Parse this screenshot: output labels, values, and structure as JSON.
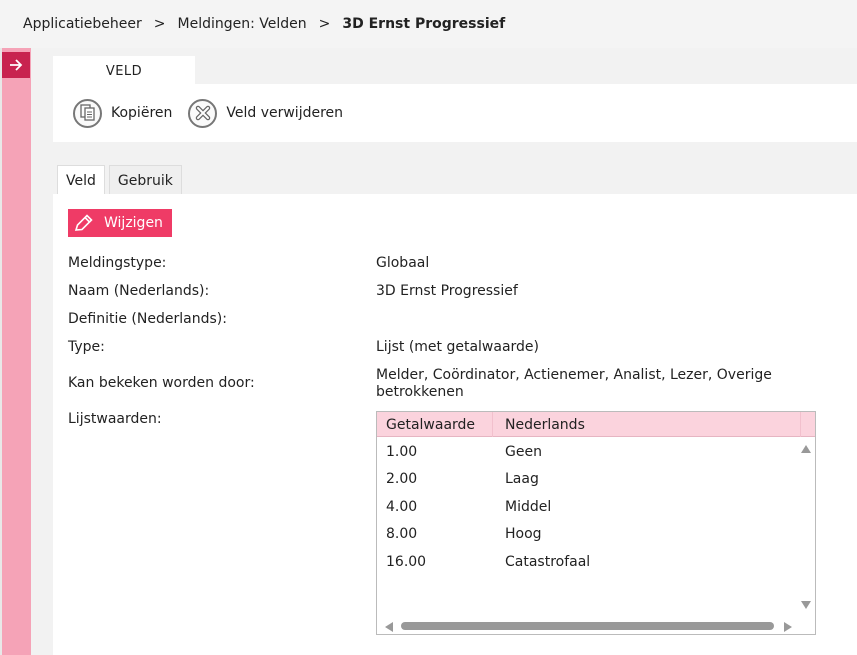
{
  "breadcrumb": {
    "items": [
      "Applicatiebeheer",
      "Meldingen: Velden",
      "3D Ernst Progressief"
    ],
    "separator": ">"
  },
  "top_tab": {
    "label": "VELD"
  },
  "toolbar": {
    "copy_label": "Kopiëren",
    "delete_label": "Veld verwijderen"
  },
  "subtabs": [
    "Veld",
    "Gebruik"
  ],
  "edit_button": {
    "label": "Wijzigen"
  },
  "fields": {
    "meldingstype": {
      "label": "Meldingstype:",
      "value": "Globaal"
    },
    "naam": {
      "label": "Naam (Nederlands):",
      "value": "3D Ernst Progressief"
    },
    "definitie": {
      "label": "Definitie (Nederlands):",
      "value": ""
    },
    "type": {
      "label": "Type:",
      "value": "Lijst (met getalwaarde)"
    },
    "bekeken": {
      "label": "Kan bekeken worden door:",
      "value": "Melder, Coördinator, Actienemer, Analist, Lezer, Overige betrokkenen"
    },
    "lijstwaarden": {
      "label": "Lijstwaarden:"
    }
  },
  "list_table": {
    "columns": [
      "Getalwaarde",
      "Nederlands"
    ],
    "rows": [
      [
        "1.00",
        "Geen"
      ],
      [
        "2.00",
        "Laag"
      ],
      [
        "4.00",
        "Middel"
      ],
      [
        "8.00",
        "Hoog"
      ],
      [
        "16.00",
        "Catastrofaal"
      ]
    ]
  },
  "colors": {
    "accent": "#ef3b66",
    "accent_dark": "#c8234f",
    "strip": "#f5a3b7",
    "table_header": "#fbd3dd"
  },
  "icons": {
    "expand": "arrow-right-icon",
    "copy": "copy-icon",
    "delete": "delete-icon",
    "edit": "pencil-icon"
  }
}
